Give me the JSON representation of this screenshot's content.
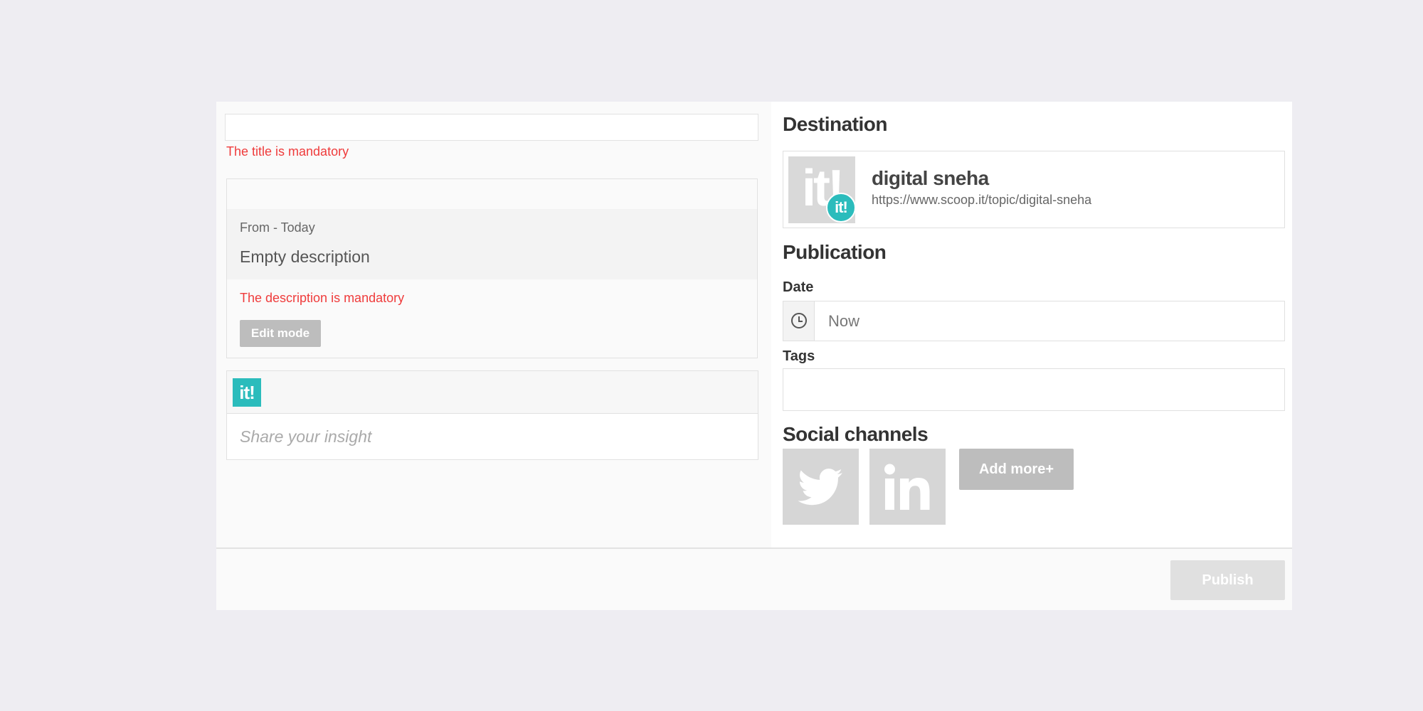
{
  "editor": {
    "title_value": "",
    "title_error": "The title is mandatory",
    "description": {
      "from_text": "From - Today",
      "empty_text": "Empty description",
      "error": "The description is mandatory",
      "edit_mode_label": "Edit mode"
    },
    "insight": {
      "logo_text": "it!",
      "placeholder": "Share your insight"
    }
  },
  "sidebar": {
    "destination": {
      "heading": "Destination",
      "logo_text": "it!",
      "badge_text": "it!",
      "topic_name": "digital sneha",
      "topic_url": "https://www.scoop.it/topic/digital-sneha"
    },
    "publication": {
      "heading": "Publication",
      "date_label": "Date",
      "date_placeholder": "Now",
      "tags_label": "Tags",
      "tags_value": ""
    },
    "social": {
      "heading": "Social channels",
      "channels": [
        "twitter-icon",
        "linkedin-icon"
      ],
      "add_more_label": "Add more+"
    }
  },
  "footer": {
    "publish_label": "Publish"
  },
  "colors": {
    "accent": "#2bbcbc",
    "error": "#ef3b3b",
    "disabled_button": "#bdbdbd",
    "page_background": "#eeedf2"
  }
}
